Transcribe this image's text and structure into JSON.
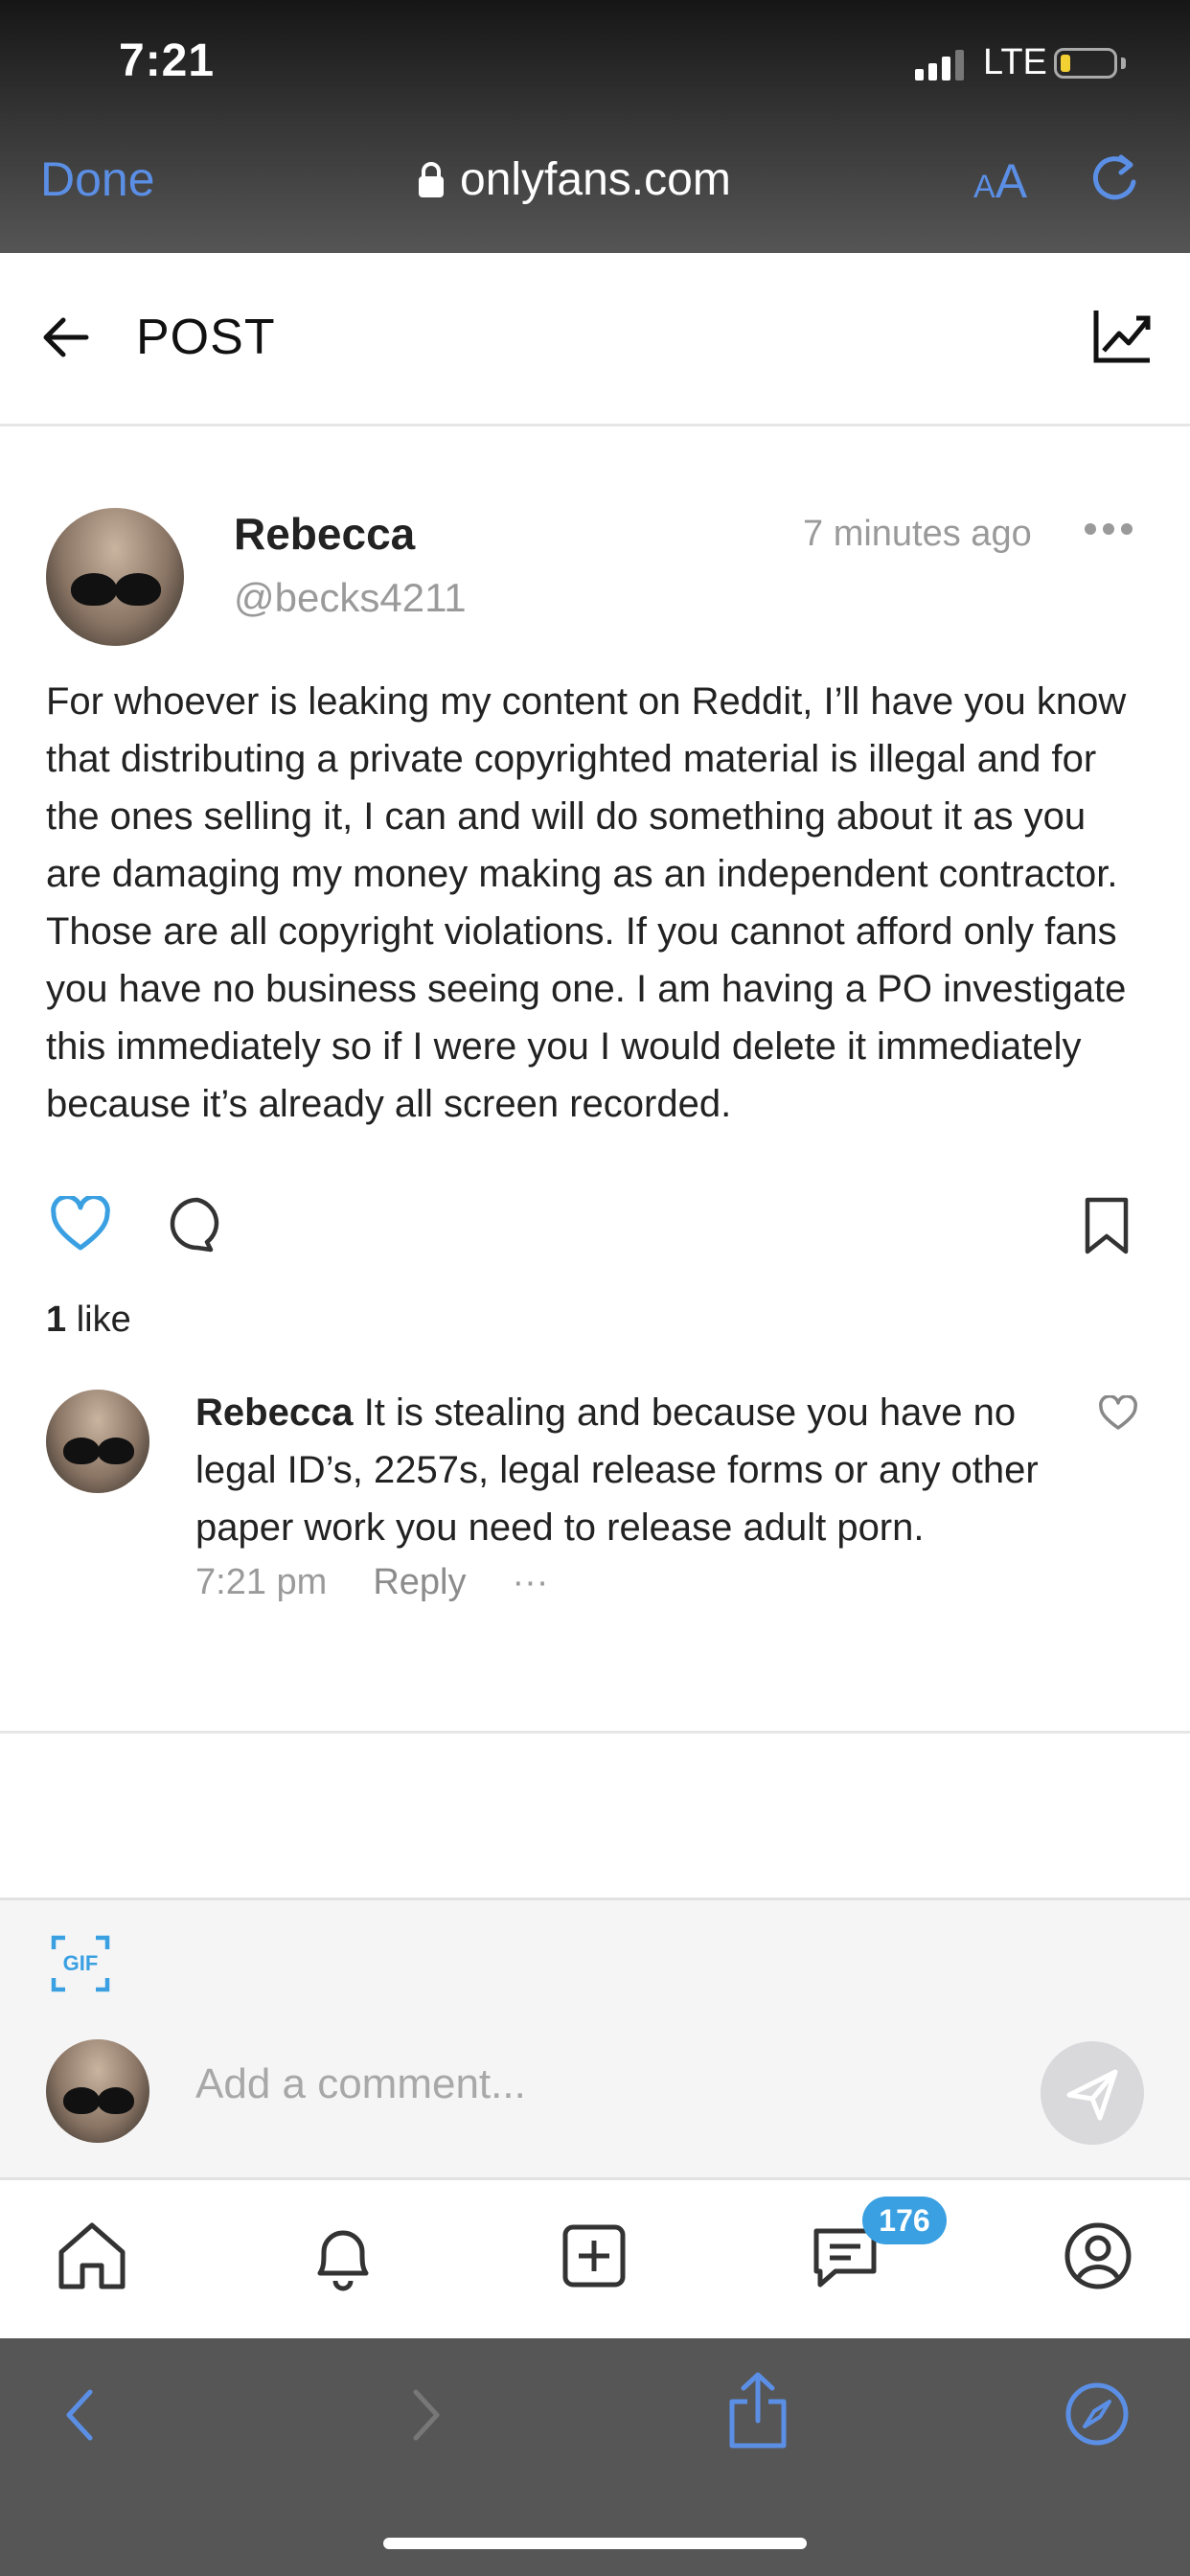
{
  "status_bar": {
    "time": "7:21",
    "network": "LTE"
  },
  "browser": {
    "done_label": "Done",
    "url": "onlyfans.com",
    "text_size_label_small": "A",
    "text_size_label_large": "A"
  },
  "header": {
    "title": "POST"
  },
  "post": {
    "author_name": "Rebecca",
    "author_handle": "@becks4211",
    "time_ago": "7 minutes ago",
    "text": "For whoever is leaking my content on Reddit, I’ll have you know that distributing a private copyrighted material is illegal and for the ones selling it, I can and will do something about it as you are damaging my money making as an independent contractor. Those are all copyright violations. If you cannot afford only fans you have no business seeing one. I am having a PO investigate this immediately so if I were you I would delete it immediately because it’s already all screen recorded.",
    "likes_count": "1",
    "likes_label": "like"
  },
  "comment": {
    "author_name": "Rebecca",
    "text": "It is stealing and because you have no legal ID’s, 2257s, legal release forms or any other paper work you need to release adult porn.",
    "time": "7:21 pm",
    "reply_label": "Reply",
    "more_label": "···"
  },
  "composer": {
    "placeholder": "Add a comment...",
    "gif_label": "GIF"
  },
  "tabbar": {
    "messages_badge": "176"
  },
  "colors": {
    "accent": "#3aa0e2",
    "ios_blue": "#5b8fe6",
    "muted": "#9a9a9a"
  }
}
